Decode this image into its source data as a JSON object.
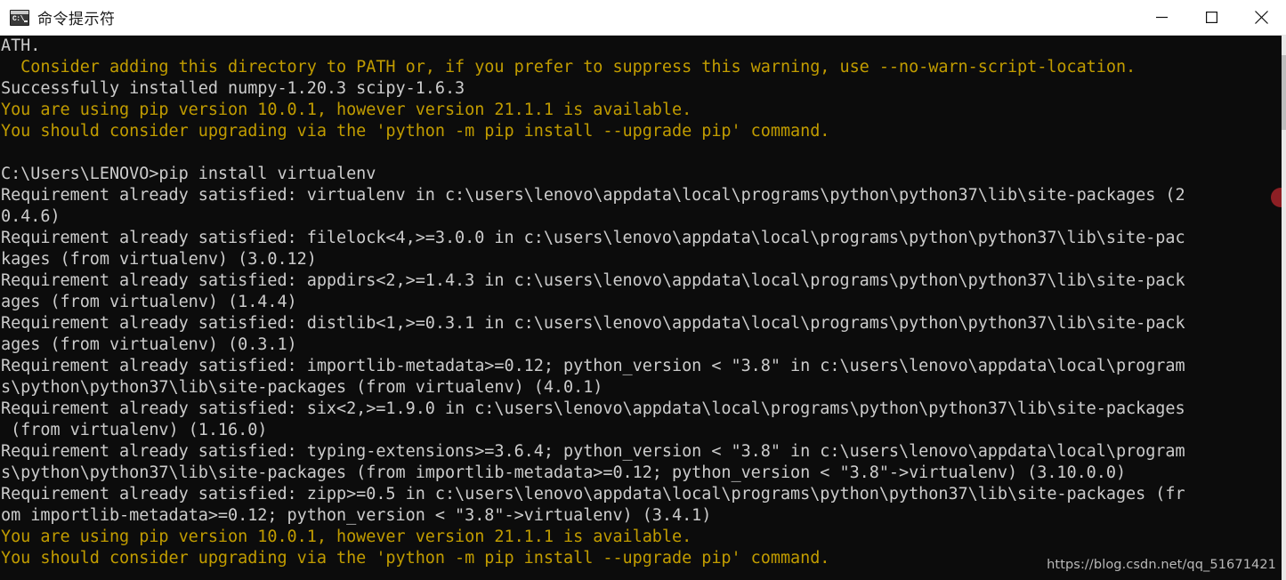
{
  "window": {
    "title": "命令提示符",
    "icon": "cmd-console-icon",
    "icon_prompt_text": "C:\\",
    "controls": [
      {
        "name": "minimize-button",
        "label": "Minimize",
        "glyph": "minimize-icon"
      },
      {
        "name": "maximize-button",
        "label": "Maximize",
        "glyph": "maximize-icon"
      },
      {
        "name": "close-button",
        "label": "Close",
        "glyph": "close-icon"
      }
    ]
  },
  "colors": {
    "console_background": "#0c0c0c",
    "text_normal": "#cccccc",
    "text_warning": "#c19c00",
    "titlebar_background": "#ffffff",
    "titlebar_text": "#1b1b1b",
    "scrollbar_track": "#e8e8e8",
    "scrollbar_thumb": "#bdbdbd",
    "marker": "#8d1f24"
  },
  "console": {
    "prompt": "C:\\Users\\LENOVO>",
    "command": "pip install virtualenv",
    "lines": [
      {
        "text": "ATH.",
        "color": "white"
      },
      {
        "text": "  Consider adding this directory to PATH or, if you prefer to suppress this warning, use --no-warn-script-location.",
        "color": "yellow"
      },
      {
        "text": "Successfully installed numpy-1.20.3 scipy-1.6.3",
        "color": "white"
      },
      {
        "text": "You are using pip version 10.0.1, however version 21.1.1 is available.",
        "color": "yellow"
      },
      {
        "text": "You should consider upgrading via the 'python -m pip install --upgrade pip' command.",
        "color": "yellow"
      },
      {
        "text": "",
        "color": "white"
      },
      {
        "text": "C:\\Users\\LENOVO>pip install virtualenv",
        "color": "white"
      },
      {
        "text": "Requirement already satisfied: virtualenv in c:\\users\\lenovo\\appdata\\local\\programs\\python\\python37\\lib\\site-packages (20.4.6)",
        "color": "white"
      },
      {
        "text": "Requirement already satisfied: filelock<4,>=3.0.0 in c:\\users\\lenovo\\appdata\\local\\programs\\python\\python37\\lib\\site-packages (from virtualenv) (3.0.12)",
        "color": "white"
      },
      {
        "text": "Requirement already satisfied: appdirs<2,>=1.4.3 in c:\\users\\lenovo\\appdata\\local\\programs\\python\\python37\\lib\\site-packages (from virtualenv) (1.4.4)",
        "color": "white"
      },
      {
        "text": "Requirement already satisfied: distlib<1,>=0.3.1 in c:\\users\\lenovo\\appdata\\local\\programs\\python\\python37\\lib\\site-packages (from virtualenv) (0.3.1)",
        "color": "white"
      },
      {
        "text": "Requirement already satisfied: importlib-metadata>=0.12; python_version < \"3.8\" in c:\\users\\lenovo\\appdata\\local\\programs\\python\\python37\\lib\\site-packages (from virtualenv) (4.0.1)",
        "color": "white"
      },
      {
        "text": "Requirement already satisfied: six<2,>=1.9.0 in c:\\users\\lenovo\\appdata\\local\\programs\\python\\python37\\lib\\site-packages (from virtualenv) (1.16.0)",
        "color": "white"
      },
      {
        "text": "Requirement already satisfied: typing-extensions>=3.6.4; python_version < \"3.8\" in c:\\users\\lenovo\\appdata\\local\\programs\\python\\python37\\lib\\site-packages (from importlib-metadata>=0.12; python_version < \"3.8\"->virtualenv) (3.10.0.0)",
        "color": "white"
      },
      {
        "text": "Requirement already satisfied: zipp>=0.5 in c:\\users\\lenovo\\appdata\\local\\programs\\python\\python37\\lib\\site-packages (from importlib-metadata>=0.12; python_version < \"3.8\"->virtualenv) (3.4.1)",
        "color": "white"
      },
      {
        "text": "You are using pip version 10.0.1, however version 21.1.1 is available.",
        "color": "yellow"
      },
      {
        "text": "You should consider upgrading via the 'python -m pip install --upgrade pip' command.",
        "color": "yellow"
      }
    ]
  },
  "watermark": {
    "text": "https://blog.csdn.net/qq_51671421"
  }
}
